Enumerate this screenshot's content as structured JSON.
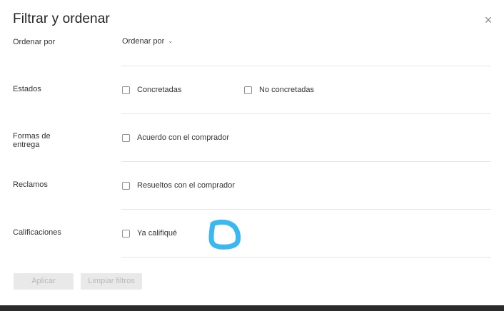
{
  "header": {
    "title": "Filtrar y ordenar",
    "close_icon": "×"
  },
  "rows": {
    "sort": {
      "label": "Ordenar por",
      "select_value": "Ordenar por",
      "chevron": "⌄"
    },
    "states": {
      "label": "Estados",
      "options": [
        "Concretadas",
        "No concretadas"
      ]
    },
    "delivery": {
      "label_line1": "Formas de",
      "label_line2": "entrega",
      "options": [
        "Acuerdo con el comprador"
      ]
    },
    "claims": {
      "label": "Reclamos",
      "options": [
        "Resueltos con el comprador"
      ]
    },
    "ratings": {
      "label": "Calificaciones",
      "options": [
        "Ya califiqué"
      ]
    }
  },
  "footer": {
    "apply_label": "Aplicar",
    "clear_label": "Limpiar filtros"
  },
  "colors": {
    "divider": "#e6e6e6",
    "button_bg": "#e9e9e9",
    "button_text": "#b8b8b8",
    "annotation": "#3bb8f0",
    "bottom_bar": "#2b2b2b"
  }
}
